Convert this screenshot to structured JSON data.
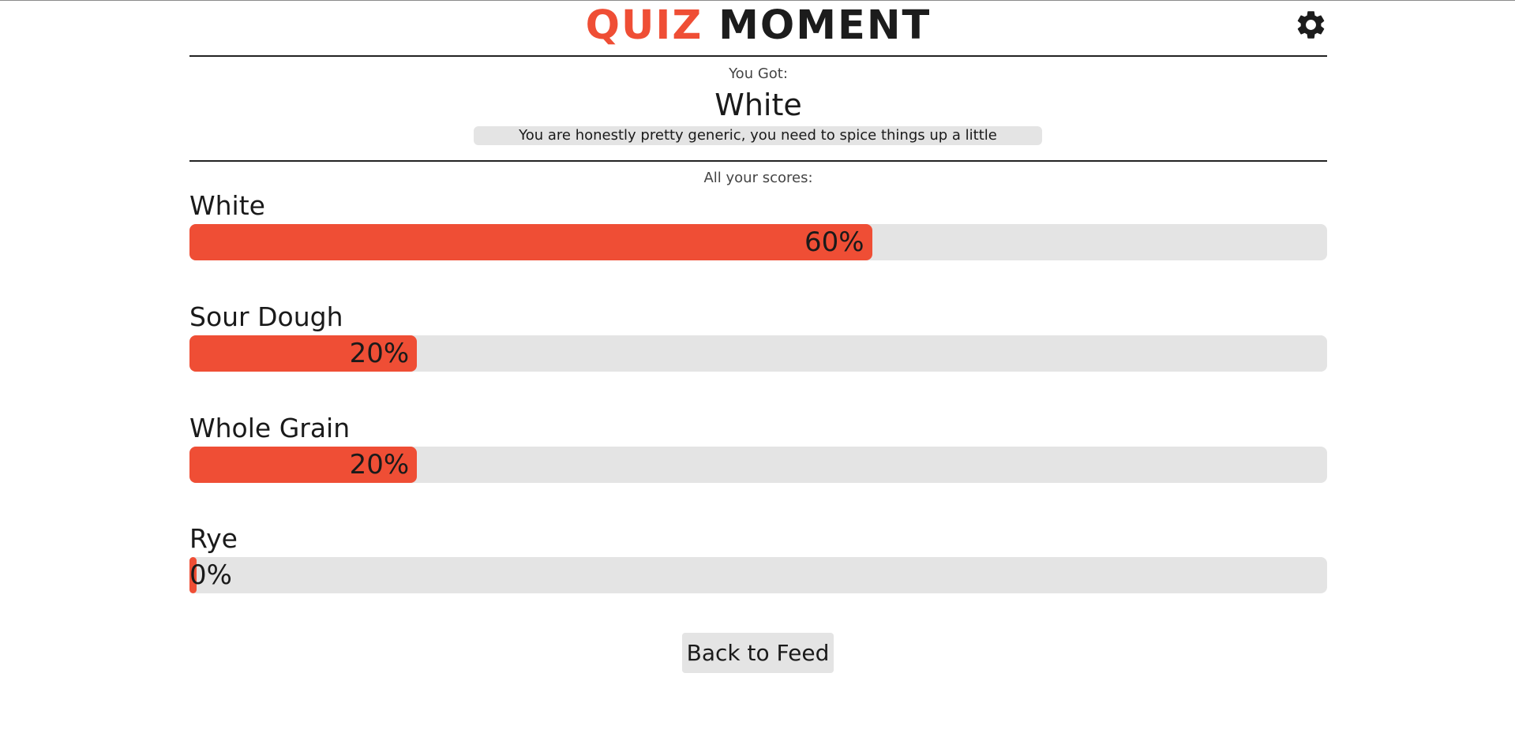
{
  "header": {
    "logo_part1": "QUIZ",
    "logo_part2": "MOMENT",
    "settings_icon": "gear-icon"
  },
  "result": {
    "intro": "You Got:",
    "name": "White",
    "description": "You are honestly pretty generic, you need to spice things up a little"
  },
  "scores": {
    "heading": "All your scores:",
    "items": [
      {
        "label": "White",
        "percent_text": "60%",
        "percent": 60
      },
      {
        "label": "Sour Dough",
        "percent_text": "20%",
        "percent": 20
      },
      {
        "label": "Whole Grain",
        "percent_text": "20%",
        "percent": 20
      },
      {
        "label": "Rye",
        "percent_text": "0%",
        "percent": 0
      }
    ]
  },
  "footer": {
    "back_label": "Back to Feed"
  },
  "colors": {
    "accent": "#ef4e35",
    "track": "#e4e4e4",
    "text": "#1a1a1a"
  }
}
